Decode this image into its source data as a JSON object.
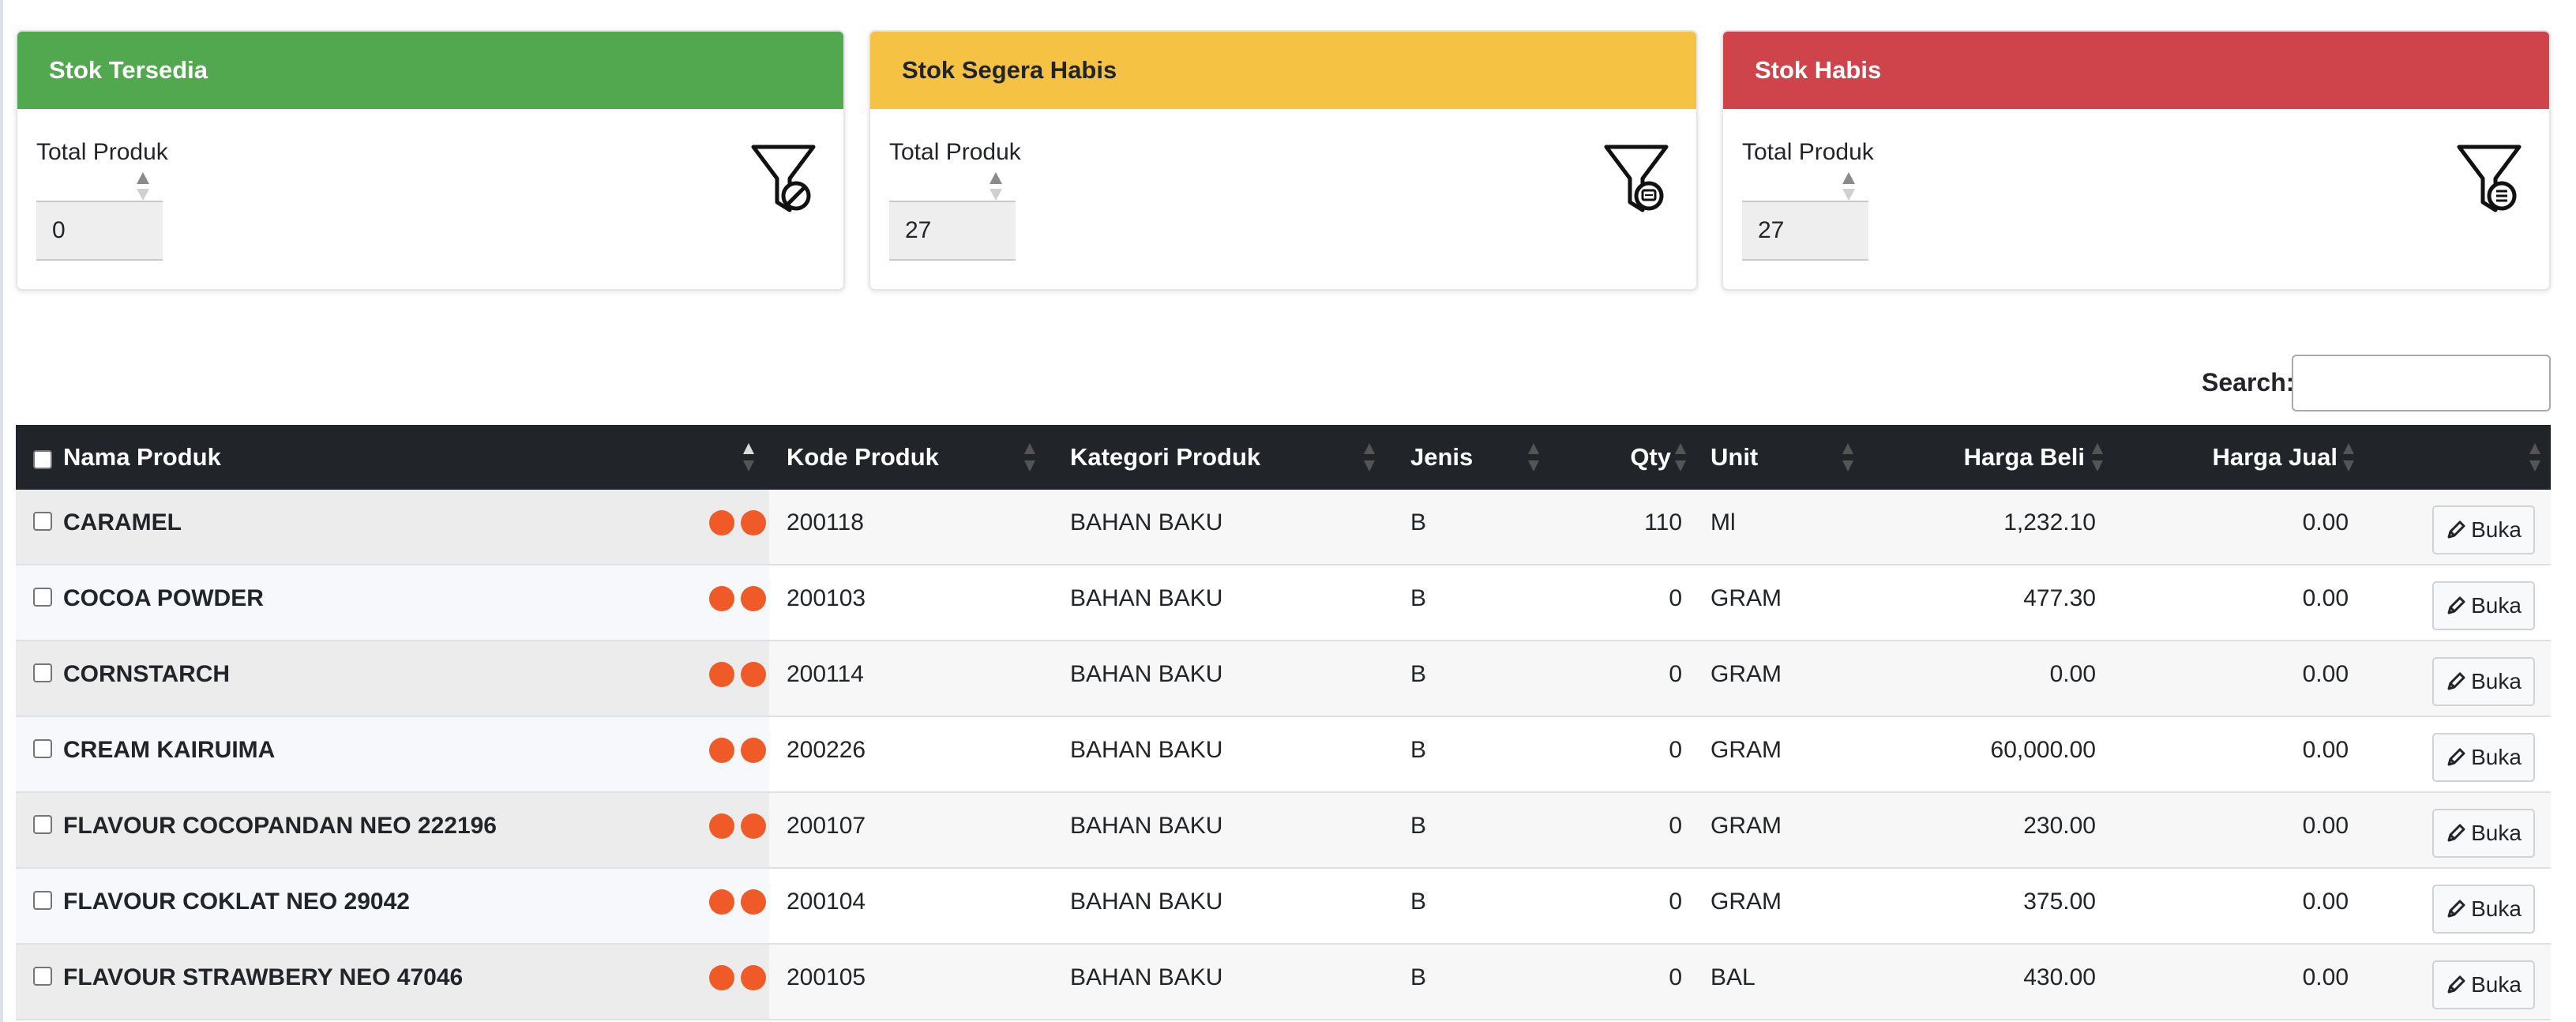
{
  "colors": {
    "available": "#52a84e",
    "low": "#f6c244",
    "empty": "#cf434a",
    "dot": "#f05a28",
    "header_bg": "#212529"
  },
  "cards": [
    {
      "title": "Stok Tersedia",
      "label": "Total Produk",
      "count": "0",
      "color": "#52a84e",
      "icon": "filter-ban-icon"
    },
    {
      "title": "Stok Segera Habis",
      "label": "Total Produk",
      "count": "27",
      "color": "#f6c244",
      "icon": "filter-alert-icon"
    },
    {
      "title": "Stok Habis",
      "label": "Total Produk",
      "count": "27",
      "color": "#cf434a",
      "icon": "filter-list-icon"
    }
  ],
  "search": {
    "label": "Search:",
    "value": ""
  },
  "table": {
    "columns": [
      "Nama Produk",
      "Kode Produk",
      "Kategori Produk",
      "Jenis",
      "Qty",
      "Unit",
      "Harga Beli",
      "Harga Jual"
    ],
    "button_label": "Buka",
    "rows": [
      {
        "name": "CARAMEL",
        "code": "200118",
        "category": "BAHAN BAKU",
        "type": "B",
        "qty": "110",
        "unit": "Ml",
        "buy": "1,232.10",
        "sell": "0.00"
      },
      {
        "name": "COCOA POWDER",
        "code": "200103",
        "category": "BAHAN BAKU",
        "type": "B",
        "qty": "0",
        "unit": "GRAM",
        "buy": "477.30",
        "sell": "0.00"
      },
      {
        "name": "CORNSTARCH",
        "code": "200114",
        "category": "BAHAN BAKU",
        "type": "B",
        "qty": "0",
        "unit": "GRAM",
        "buy": "0.00",
        "sell": "0.00"
      },
      {
        "name": "CREAM KAIRUIMA",
        "code": "200226",
        "category": "BAHAN BAKU",
        "type": "B",
        "qty": "0",
        "unit": "GRAM",
        "buy": "60,000.00",
        "sell": "0.00"
      },
      {
        "name": "FLAVOUR COCOPANDAN NEO 222196",
        "code": "200107",
        "category": "BAHAN BAKU",
        "type": "B",
        "qty": "0",
        "unit": "GRAM",
        "buy": "230.00",
        "sell": "0.00"
      },
      {
        "name": "FLAVOUR COKLAT NEO 29042",
        "code": "200104",
        "category": "BAHAN BAKU",
        "type": "B",
        "qty": "0",
        "unit": "GRAM",
        "buy": "375.00",
        "sell": "0.00"
      },
      {
        "name": "FLAVOUR STRAWBERY NEO 47046",
        "code": "200105",
        "category": "BAHAN BAKU",
        "type": "B",
        "qty": "0",
        "unit": "BAL",
        "buy": "430.00",
        "sell": "0.00"
      }
    ]
  }
}
